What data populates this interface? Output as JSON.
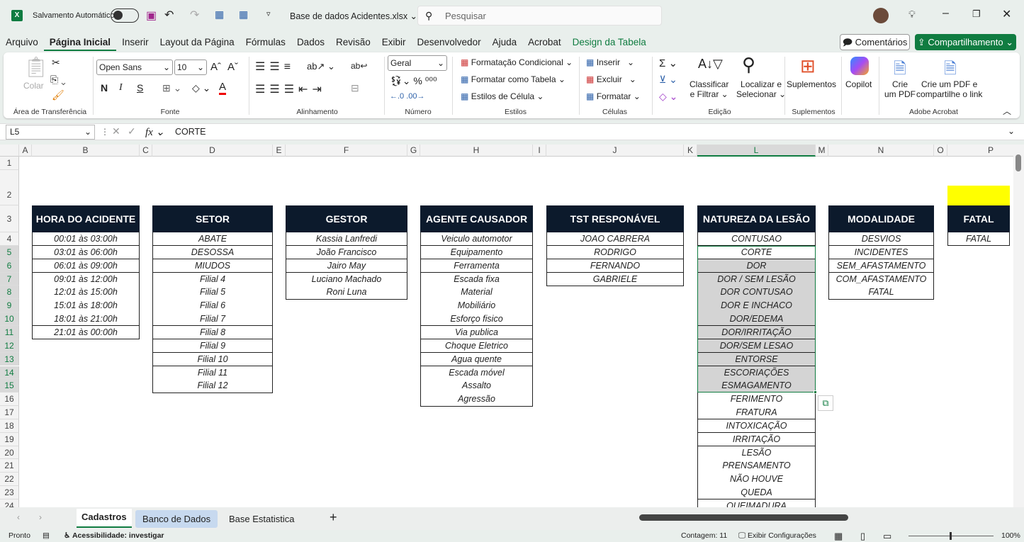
{
  "titlebar": {
    "autosave_label": "Salvamento Automático",
    "filename": "Base de dados Acidentes.xlsx",
    "search_placeholder": "Pesquisar"
  },
  "menu": [
    "Arquivo",
    "Página Inicial",
    "Inserir",
    "Layout da Página",
    "Fórmulas",
    "Dados",
    "Revisão",
    "Exibir",
    "Desenvolvedor",
    "Ajuda",
    "Acrobat",
    "Design da Tabela"
  ],
  "comments_label": "Comentários",
  "share_label": "Compartilhamento",
  "ribbon": {
    "paste": "Colar",
    "clipboard": "Área de Transferência",
    "font_name": "Open Sans",
    "font_size": "10",
    "bold": "N",
    "italic": "I",
    "underline": "S",
    "font_group": "Fonte",
    "align_group": "Alinhamento",
    "number_format": "Geral",
    "number_group": "Número",
    "cond_format": "Formatação Condicional",
    "format_table": "Formatar como Tabela",
    "cell_styles": "Estilos de Célula",
    "styles_group": "Estilos",
    "insert": "Inserir",
    "delete": "Excluir",
    "format": "Formatar",
    "cells_group": "Células",
    "sort1": "Classificar",
    "sort2": "e Filtrar",
    "find1": "Localizar e",
    "find2": "Selecionar",
    "edit_group": "Edição",
    "addins": "Suplementos",
    "addins_group": "Suplementos",
    "copilot": "Copilot",
    "pdf1a": "Crie",
    "pdf1b": "um PDF",
    "pdf2a": "Crie um PDF e",
    "pdf2b": "compartilhe o link",
    "acrobat_group": "Adobe Acrobat"
  },
  "formula": {
    "name_box": "L5",
    "value": "CORTE"
  },
  "columns": [
    "A",
    "B",
    "C",
    "D",
    "E",
    "F",
    "G",
    "H",
    "I",
    "J",
    "K",
    "L",
    "M",
    "N",
    "O",
    "P"
  ],
  "rows": [
    "1",
    "2",
    "3",
    "4",
    "5",
    "6",
    "7",
    "8",
    "9",
    "10",
    "11",
    "12",
    "13",
    "14",
    "15",
    "16",
    "17",
    "18",
    "19",
    "20",
    "21",
    "22",
    "23",
    "24"
  ],
  "tables": [
    {
      "col": "B",
      "header": "HORA DO ACIDENTE",
      "items": [
        "00:01 às 03:00h",
        "03:01 às 06:00h",
        "06:01 às 09:00h",
        "09:01 às 12:00h",
        "12:01 às 15:00h",
        "15:01 às 18:00h",
        "18:01 às 21:00h",
        "21:01 às 00:00h"
      ]
    },
    {
      "col": "D",
      "header": "SETOR",
      "items": [
        "ABATE",
        "DESOSSA",
        "MIUDOS",
        "Filial 4",
        "Filial 5",
        "Filial 6",
        "Filial 7",
        "Filial 8",
        "Filial 9",
        "Filial 10",
        "Filial 11",
        "Filial 12"
      ]
    },
    {
      "col": "F",
      "header": "GESTOR",
      "items": [
        "Kassia Lanfredi",
        "João Francisco",
        "Jairo May",
        "Luciano Machado",
        "Roni Luna"
      ]
    },
    {
      "col": "H",
      "header": "AGENTE CAUSADOR",
      "items": [
        "Veiculo automotor",
        "Equipamento",
        "Ferramenta",
        "Escada fixa",
        "Material",
        "Mobiliário",
        "Esforço fisico",
        "Via publica",
        "Choque Eletrico",
        "Agua quente",
        "Escada móvel",
        "Assalto",
        "Agressão"
      ]
    },
    {
      "col": "J",
      "header": "TST RESPONÁVEL",
      "items": [
        "JOAO CABRERA",
        "RODRIGO",
        "FERNANDO",
        "GABRIELE"
      ]
    },
    {
      "col": "L",
      "header": "NATUREZA DA LESÃO",
      "items": [
        "CONTUSAO",
        "CORTE",
        "DOR",
        "DOR / SEM LESÃO",
        "DOR CONTUSAO",
        "DOR E INCHACO",
        "DOR/EDEMA",
        "DOR/IRRITAÇÃO",
        "DOR/SEM LESAO",
        "ENTORSE",
        "ESCORIAÇÕES",
        "ESMAGAMENTO",
        "FERIMENTO",
        "FRATURA",
        "INTOXICAÇÃO",
        "IRRITAÇÃO",
        "LESÃO",
        "PRENSAMENTO",
        "NÃO HOUVE",
        "QUEDA",
        "QUEIMADURA"
      ]
    },
    {
      "col": "N",
      "header": "MODALIDADE",
      "items": [
        "DESVIOS",
        "INCIDENTES",
        "SEM_AFASTAMENTO",
        "COM_AFASTAMENTO",
        "FATAL"
      ]
    },
    {
      "col": "P",
      "header": "FATAL",
      "items": [
        "FATAL"
      ]
    }
  ],
  "selection": {
    "range": "L5:L15",
    "active": "L5"
  },
  "colors": {
    "header_bg": "#0c1a2c",
    "selection_fill": "#d4d4d4",
    "selection_border": "#107c41",
    "highlight": "#ffff00",
    "accent": "#107c41"
  },
  "sheets": [
    "Cadastros",
    "Banco de Dados",
    "Base Estatistica"
  ],
  "status": {
    "ready": "Pronto",
    "accessibility": "Acessibilidade: investigar",
    "count": "Contagem: 11",
    "display_settings": "Exibir Configurações",
    "zoom": "100%"
  }
}
